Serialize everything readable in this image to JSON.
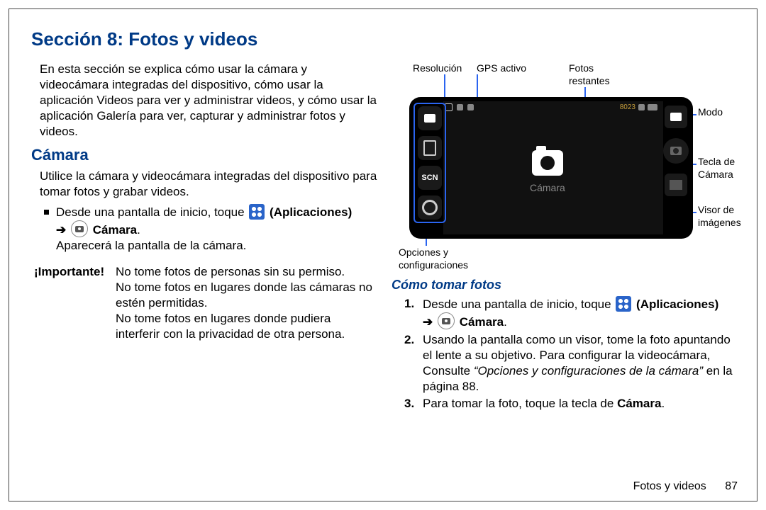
{
  "section_title": "Sección 8: Fotos y videos",
  "intro": "En esta sección se explica cómo usar la cámara y videocámara integradas del dispositivo, cómo usar la aplicación Videos para ver y administrar videos, y cómo usar la aplicación Galería para ver, capturar y administrar fotos y videos.",
  "camara": {
    "heading": "Cámara",
    "lead": "Utilice la cámara y videocámara integradas del dispositivo para tomar fotos y grabar videos.",
    "step_pre": "Desde una pantalla de inicio, toque ",
    "apps_label": "(Aplicaciones)",
    "arrow": "➔",
    "camera_label": "Cámara",
    "period": ".",
    "after": "Aparecerá la pantalla de la cámara.",
    "important_label": "¡Importante! ",
    "important_1": "No tome fotos de personas sin su permiso.",
    "important_2": "No tome fotos en lugares donde las cámaras no estén permitidas.",
    "important_3": "No tome fotos en lugares donde pudiera interferir con la privacidad de otra persona."
  },
  "diagram": {
    "resolucion": "Resolución",
    "gps": "GPS activo",
    "fotos_restantes": "Fotos restantes",
    "modo": "Modo",
    "tecla": "Tecla de Cámara",
    "visor": "Visor de imágenes",
    "opciones": "Opciones y configuraciones",
    "scn": "SCN",
    "center": "Cámara",
    "count": "8023"
  },
  "howto": {
    "heading": "Cómo tomar fotos",
    "s1_pre": "Desde una pantalla de inicio, toque ",
    "apps_label": "(Aplicaciones)",
    "arrow": "➔",
    "camera_label": "Cámara",
    "period": ".",
    "s2a": "Usando la pantalla como un visor, tome la foto apuntando el lente a su objetivo. Para configurar la videocámara, Consulte ",
    "s2b": "“Opciones y configuraciones de la cámara”",
    "s2c": " en la página 88.",
    "s3a": "Para tomar la foto, toque la tecla de ",
    "s3b": "Cámara",
    "s3c": "."
  },
  "footer": {
    "label": "Fotos y videos",
    "page": "87"
  }
}
